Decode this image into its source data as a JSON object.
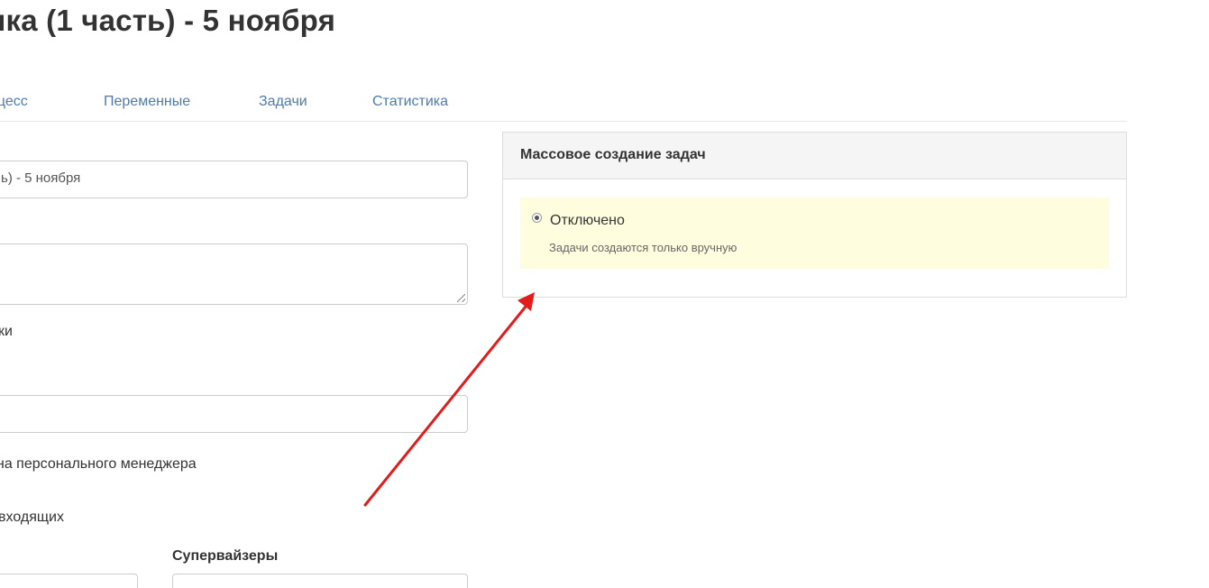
{
  "page": {
    "title": "ика (1 часть) - 5 ноября"
  },
  "tabs": [
    {
      "label": "оцесс"
    },
    {
      "label": "Переменные"
    },
    {
      "label": "Задачи"
    },
    {
      "label": "Статистика"
    }
  ],
  "form": {
    "name_value": "ь) - 5 ноября",
    "label_1": "ки",
    "label_2": "на персонального менеджера",
    "label_3": "входящих",
    "supervisors_label": "Супервайзеры"
  },
  "mass_panel": {
    "title": "Массовое создание задач",
    "option_label": "Отключено",
    "option_hint": "Задачи создаются только вручную",
    "option_selected": true
  },
  "annotation": {
    "arrow_color": "#e31b1b"
  },
  "colors": {
    "tab_link": "#4f7bab",
    "highlight_bg": "#fefedf",
    "panel_heading_bg": "#f5f5f5"
  }
}
